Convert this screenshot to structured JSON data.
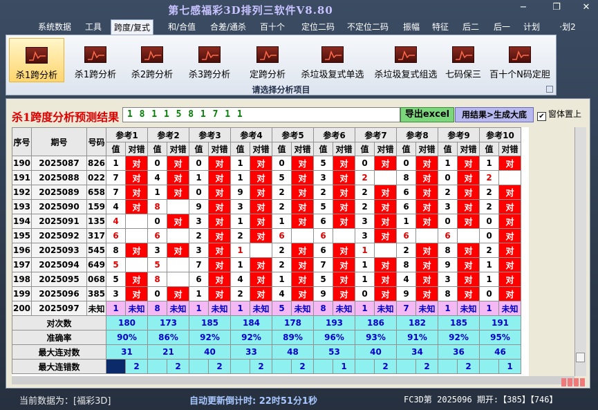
{
  "window": {
    "title": "第七感福彩3D排列三软件V8.80",
    "controls": {
      "minimize": "−",
      "restore": "❐",
      "close": "✕"
    }
  },
  "menu": [
    "系统数据",
    "工具",
    "跨度/复式",
    "和/合值",
    "合差/通杀",
    "百十个",
    "定位二码",
    "不定位二码",
    "振幅",
    "特征",
    "后二",
    "后一",
    "计划",
    "·划2"
  ],
  "menu_active": 2,
  "ribbon": {
    "buttons": [
      "杀1跨分析",
      "杀1跨分析",
      "杀2跨分析",
      "杀3跨分析",
      "定跨分析",
      "杀垃圾复式单选",
      "杀垃圾复式组选",
      "七码保三",
      "百十个N码定胆"
    ],
    "active": 0,
    "group_label": "请选择分析项目"
  },
  "result": {
    "title": "杀1跨度分析预测结果",
    "value": "1 8 1 1 5 8 1 7 1 1",
    "export_button": "导出excel",
    "generate_button": "用结果>生成大底",
    "ontop_label": "窗体置上",
    "ontop_checked": true
  },
  "table": {
    "headers": {
      "index": "序号",
      "period": "期号",
      "number": "号码",
      "value": "值",
      "hit": "对错"
    },
    "refs": [
      "参考1",
      "参考2",
      "参考3",
      "参考4",
      "参考5",
      "参考6",
      "参考7",
      "参考8",
      "参考9",
      "参考10"
    ],
    "hit_text": "对",
    "unknown_text": "未知",
    "rows": [
      {
        "idx": "190",
        "period": "2025087",
        "num": "826",
        "vals": [
          "1",
          "0",
          "0",
          "1",
          "0",
          "5",
          "0",
          "0",
          "1",
          "1"
        ],
        "hits": [
          1,
          1,
          1,
          1,
          1,
          1,
          1,
          1,
          1,
          1
        ]
      },
      {
        "idx": "191",
        "period": "2025088",
        "num": "022",
        "vals": [
          "7",
          "4",
          "1",
          "1",
          "5",
          "3",
          "2",
          "8",
          "0",
          "2"
        ],
        "hits": [
          1,
          1,
          1,
          1,
          1,
          1,
          0,
          1,
          1,
          0
        ]
      },
      {
        "idx": "192",
        "period": "2025089",
        "num": "658",
        "vals": [
          "7",
          "1",
          "0",
          "9",
          "2",
          "2",
          "2",
          "6",
          "2",
          "2"
        ],
        "hits": [
          1,
          1,
          1,
          1,
          1,
          1,
          1,
          1,
          1,
          1
        ]
      },
      {
        "idx": "193",
        "period": "2025090",
        "num": "159",
        "vals": [
          "4",
          "8",
          "9",
          "3",
          "2",
          "5",
          "2",
          "6",
          "3",
          "2"
        ],
        "hits": [
          1,
          0,
          1,
          1,
          1,
          1,
          1,
          1,
          1,
          1
        ]
      },
      {
        "idx": "194",
        "period": "2025091",
        "num": "135",
        "vals": [
          "4",
          "0",
          "3",
          "1",
          "1",
          "6",
          "3",
          "1",
          "0",
          "0"
        ],
        "hits": [
          0,
          1,
          1,
          1,
          1,
          1,
          1,
          1,
          1,
          1
        ]
      },
      {
        "idx": "195",
        "period": "2025092",
        "num": "317",
        "vals": [
          "6",
          "6",
          "2",
          "2",
          "6",
          "6",
          "3",
          "6",
          "6",
          "0"
        ],
        "hits": [
          0,
          0,
          1,
          1,
          0,
          0,
          1,
          0,
          0,
          1
        ]
      },
      {
        "idx": "196",
        "period": "2025093",
        "num": "545",
        "vals": [
          "8",
          "3",
          "3",
          "1",
          "2",
          "6",
          "1",
          "2",
          "8",
          "2"
        ],
        "hits": [
          1,
          1,
          1,
          0,
          1,
          1,
          0,
          1,
          1,
          1
        ]
      },
      {
        "idx": "197",
        "period": "2025094",
        "num": "649",
        "vals": [
          "5",
          "5",
          "7",
          "1",
          "2",
          "7",
          "1",
          "8",
          "9",
          "1"
        ],
        "hits": [
          0,
          0,
          1,
          1,
          1,
          1,
          1,
          1,
          1,
          1
        ]
      },
      {
        "idx": "198",
        "period": "2025095",
        "num": "068",
        "vals": [
          "5",
          "8",
          "6",
          "4",
          "1",
          "5",
          "1",
          "4",
          "3",
          "1"
        ],
        "hits": [
          1,
          0,
          1,
          1,
          1,
          1,
          1,
          1,
          1,
          1
        ]
      },
      {
        "idx": "199",
        "period": "2025096",
        "num": "385",
        "vals": [
          "3",
          "0",
          "1",
          "2",
          "4",
          "9",
          "0",
          "9",
          "8",
          "0"
        ],
        "hits": [
          1,
          1,
          1,
          1,
          1,
          1,
          1,
          1,
          1,
          1
        ]
      }
    ],
    "last": {
      "idx": "200",
      "period": "2025097",
      "num": "未知",
      "vals": [
        "1",
        "8",
        "1",
        "1",
        "5",
        "8",
        "1",
        "7",
        "1",
        "1"
      ]
    },
    "stats": [
      {
        "label": "对次数",
        "vals": [
          "180",
          "173",
          "185",
          "184",
          "178",
          "193",
          "186",
          "182",
          "185",
          "191"
        ]
      },
      {
        "label": "准确率",
        "vals": [
          "90%",
          "86%",
          "92%",
          "92%",
          "89%",
          "96%",
          "93%",
          "91%",
          "92%",
          "95%"
        ]
      },
      {
        "label": "最大连对数",
        "vals": [
          "31",
          "21",
          "40",
          "33",
          "48",
          "53",
          "40",
          "34",
          "36",
          "46"
        ]
      },
      {
        "label": "最大连错数",
        "vals": [
          "2",
          "2",
          "2",
          "2",
          "2",
          "1",
          "2",
          "2",
          "2",
          "1"
        ]
      }
    ]
  },
  "status": {
    "current_data": "当前数据为：[福彩3D]",
    "countdown": "自动更新倒计时:  22时51分1秒",
    "draw": "FC3D第 2025096 期开:【385】【746】"
  },
  "colors": {
    "hit": "#ff0000",
    "unknown_row": "#f4b8f4",
    "stats": "#8ff0f0",
    "title_red": "#e00000"
  }
}
